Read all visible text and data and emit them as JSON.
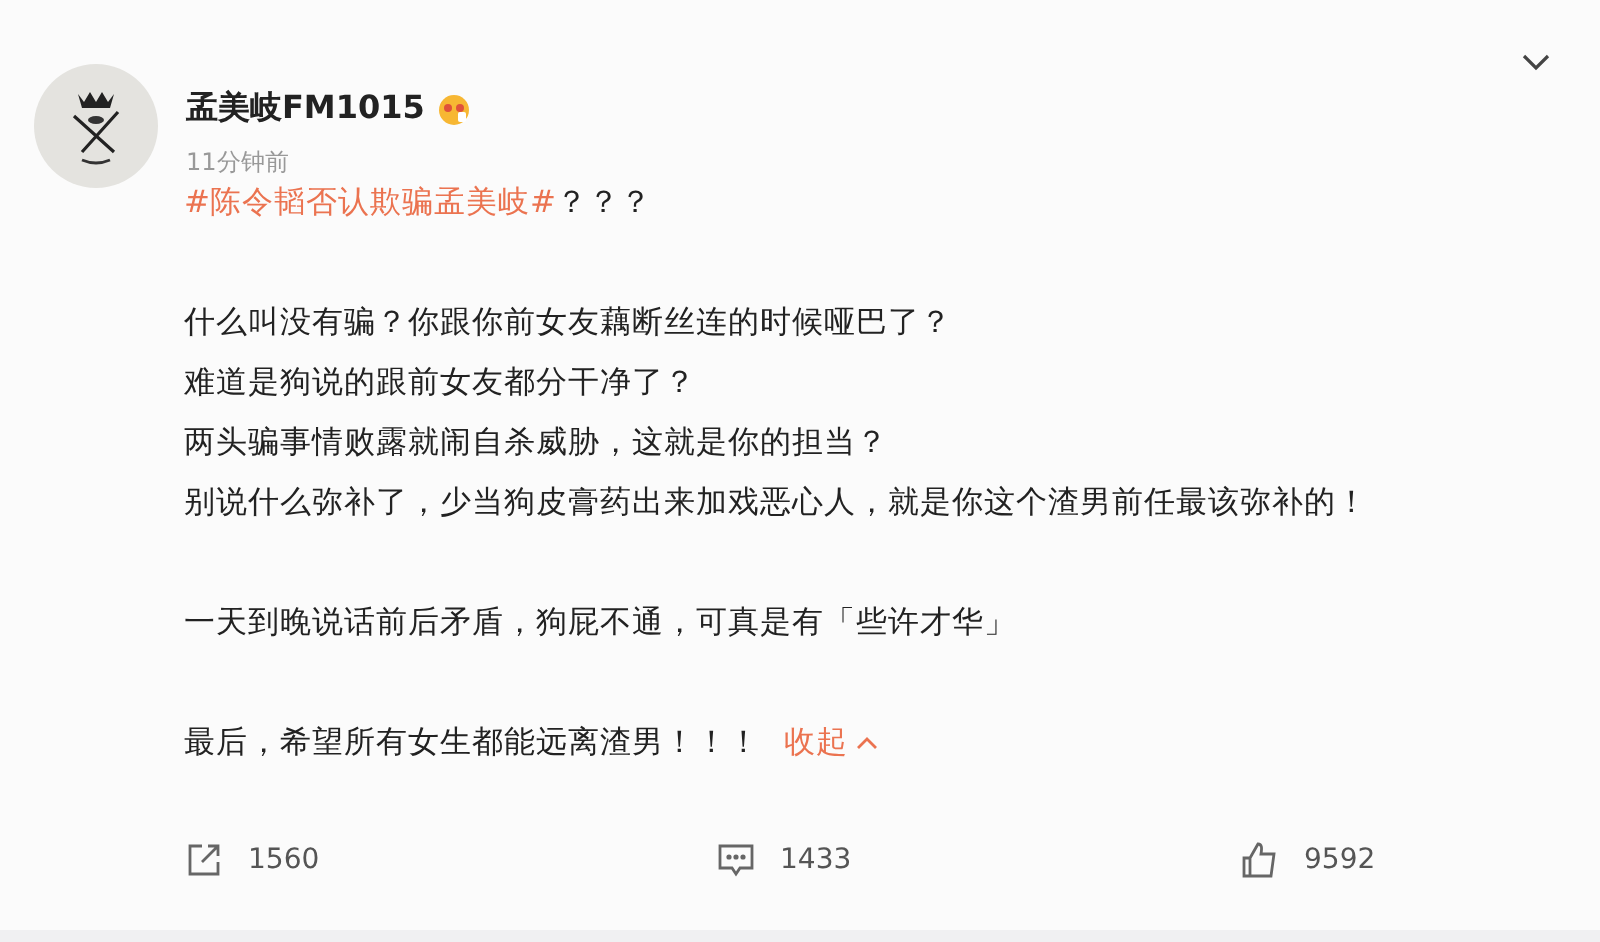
{
  "post": {
    "author": "孟美岐FM1015",
    "time": "11分钟前",
    "topic": "#陈令韬否认欺骗孟美岐#",
    "topic_suffix": "？？？",
    "paragraphs": [
      [
        "什么叫没有骗？你跟你前女友藕断丝连的时候哑巴了？",
        "难道是狗说的跟前女友都分干净了？",
        "两头骗事情败露就闹自杀威胁，这就是你的担当？",
        "别说什么弥补了，少当狗皮膏药出来加戏恶心人，就是你这个渣男前任最该弥补的！"
      ],
      [
        "一天到晚说话前后矛盾，狗屁不通，可真是有「些许才华」"
      ],
      [
        "最后，希望所有女生都能远离渣男！！！"
      ]
    ],
    "collapse_link": "收起",
    "actions": [
      {
        "kind": "share",
        "count": "1560"
      },
      {
        "kind": "comment",
        "count": "1433"
      },
      {
        "kind": "like",
        "count": "9592"
      }
    ]
  }
}
